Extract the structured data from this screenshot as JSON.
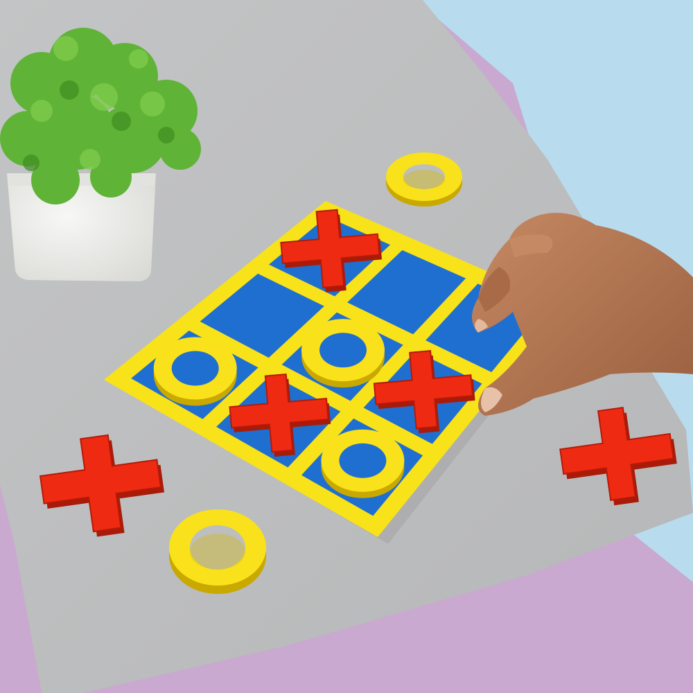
{
  "scene": {
    "description_kind": "photo",
    "colors": {
      "background_purple": "#c9a9cf",
      "background_blue": "#b8dcee",
      "mat_gray": "#bdbebf",
      "board_yellow": "#f8e21a",
      "board_blue": "#1f6fd0",
      "x_red": "#ee2a12",
      "o_yellow": "#f9e11b",
      "plant_green": "#5fb336",
      "pot_white": "#ececea",
      "skin": "#b3754f"
    }
  },
  "board": {
    "grid": [
      [
        "X",
        "",
        ""
      ],
      [
        "",
        "O",
        "X"
      ],
      [
        "O",
        "X",
        "O"
      ]
    ],
    "bottom_row_empty": true
  },
  "loose_pieces": {
    "x_count": 2,
    "o_count": 2
  },
  "icons": [
    "plant-icon",
    "hand-icon"
  ]
}
